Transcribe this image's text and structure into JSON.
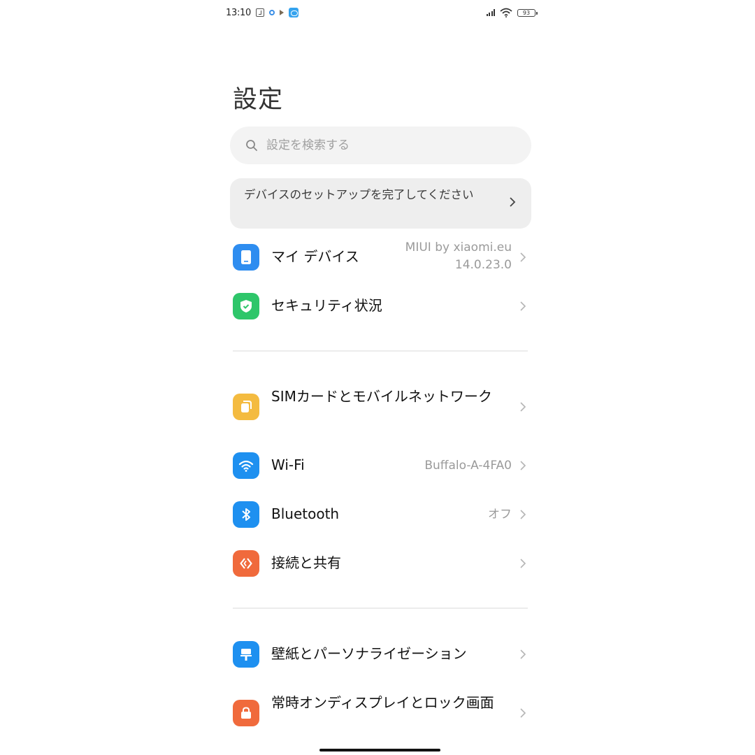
{
  "status_bar": {
    "time": "13:10",
    "battery": "93",
    "icons_left": [
      "nfc-icon",
      "gear-icon",
      "play-icon",
      "cloud-icon"
    ],
    "icons_right": [
      "signal-icon",
      "wifi-icon",
      "battery-icon"
    ]
  },
  "header": {
    "title": "設定"
  },
  "search": {
    "placeholder": "設定を検索する",
    "value": ""
  },
  "setup_banner": {
    "text": "デバイスのセットアップを完了してください"
  },
  "sections": [
    {
      "items": [
        {
          "label": "マイ デバイス",
          "value_line1": "MIUI by xiaomi.eu",
          "value_line2": "14.0.23.0",
          "icon": "phone-icon",
          "color": "#2e8df0"
        },
        {
          "label": "セキュリティ状況",
          "value": "",
          "icon": "shield-check-icon",
          "color": "#2ec66a"
        }
      ]
    },
    {
      "items": [
        {
          "label": "SIMカードとモバイルネットワーク",
          "value": "",
          "icon": "sim-card-icon",
          "color": "#f4bb40"
        },
        {
          "label": "Wi-Fi",
          "value": "Buffalo-A-4FA0",
          "icon": "wifi-icon",
          "color": "#1e90f0"
        },
        {
          "label": "Bluetooth",
          "value": "オフ",
          "icon": "bluetooth-icon",
          "color": "#1e90f0"
        },
        {
          "label": "接続と共有",
          "value": "",
          "icon": "connection-share-icon",
          "color": "#f06a3c"
        }
      ]
    },
    {
      "items": [
        {
          "label": "壁紙とパーソナライゼーション",
          "value": "",
          "icon": "paint-brush-icon",
          "color": "#1e90f0"
        },
        {
          "label": "常時オンディスプレイとロック画面",
          "value": "",
          "icon": "lock-icon",
          "color": "#f06a3c"
        }
      ]
    }
  ]
}
